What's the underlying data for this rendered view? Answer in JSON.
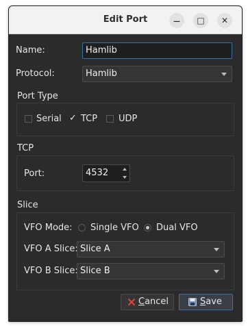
{
  "window": {
    "title": "Edit Port",
    "controls": {
      "minimize": "—",
      "maximize": "□",
      "close": "✕"
    }
  },
  "form": {
    "name_label": "Name:",
    "name_value": "Hamlib",
    "protocol_label": "Protocol:",
    "protocol_value": "Hamlib"
  },
  "port_type": {
    "title": "Port Type",
    "options": [
      {
        "label": "Serial",
        "checked": false
      },
      {
        "label": "TCP",
        "checked": true
      },
      {
        "label": "UDP",
        "checked": false
      }
    ]
  },
  "tcp": {
    "title": "TCP",
    "port_label": "Port:",
    "port_value": "4532"
  },
  "slice": {
    "title": "Slice",
    "vfo_mode_label": "VFO Mode:",
    "single_vfo": "Single VFO",
    "dual_vfo": "Dual VFO",
    "selected_mode": "Dual VFO",
    "vfo_a_label": "VFO A Slice:",
    "vfo_a_value": "Slice A",
    "vfo_b_label": "VFO B Slice:",
    "vfo_b_value": "Slice B"
  },
  "buttons": {
    "cancel_mnemonic": "C",
    "cancel_rest": "ancel",
    "save_mnemonic": "S",
    "save_rest": "ave"
  },
  "colors": {
    "accent": "#3f6fa8",
    "cancel_icon": "#d9453f",
    "dialog_bg": "#2b2b2b"
  }
}
